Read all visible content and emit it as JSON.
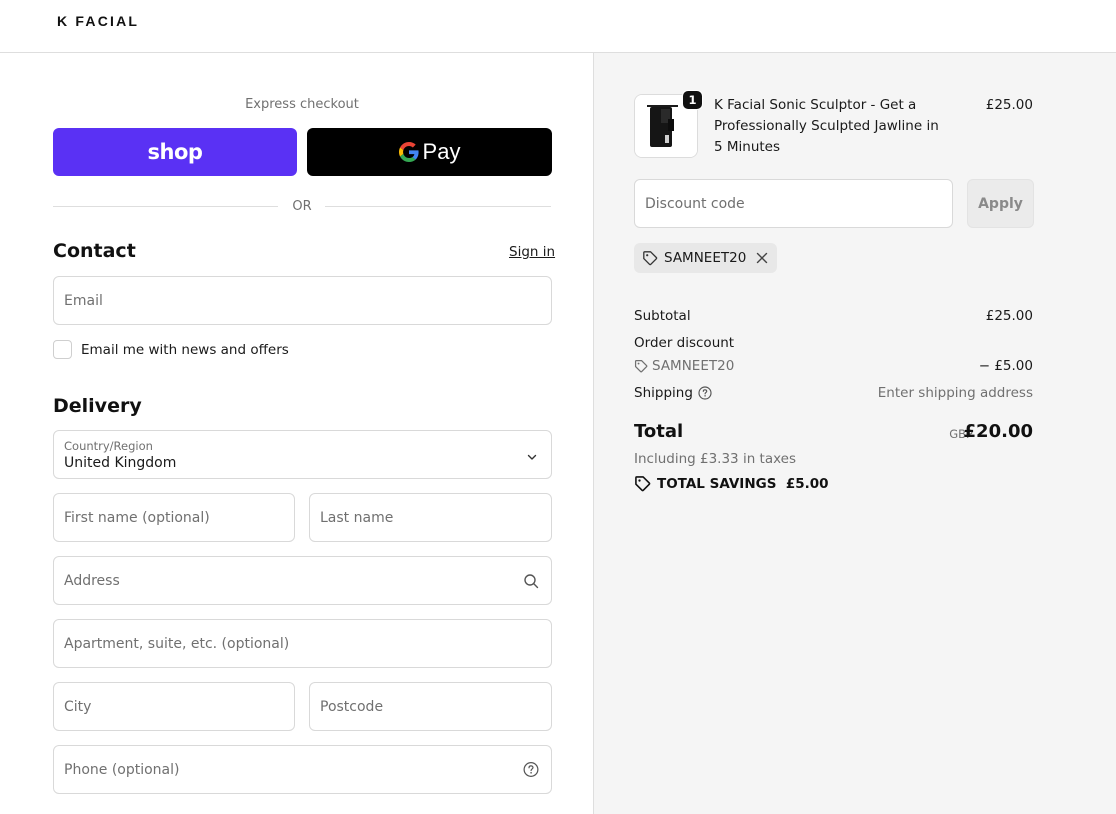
{
  "brand": {
    "logo_text": "K FACIAL"
  },
  "express": {
    "label": "Express checkout",
    "shop_label": "shop",
    "gpay_label": "Pay",
    "divider_text": "OR"
  },
  "contact": {
    "heading": "Contact",
    "signin_label": "Sign in",
    "email_placeholder": "Email",
    "newsletter_label": "Email me with news and offers"
  },
  "delivery": {
    "heading": "Delivery",
    "country_label": "Country/Region",
    "country_value": "United Kingdom",
    "first_name_placeholder": "First name (optional)",
    "last_name_placeholder": "Last name",
    "address_placeholder": "Address",
    "apartment_placeholder": "Apartment, suite, etc. (optional)",
    "city_placeholder": "City",
    "postcode_placeholder": "Postcode",
    "phone_placeholder": "Phone (optional)"
  },
  "order": {
    "item": {
      "quantity": "1",
      "title": "K Facial Sonic Sculptor - Get a Professionally Sculpted Jawline in 5 Minutes",
      "price": "£25.00"
    },
    "discount_placeholder": "Discount code",
    "apply_label": "Apply",
    "applied_code": "SAMNEET20",
    "subtotal_label": "Subtotal",
    "subtotal_value": "£25.00",
    "order_discount_label": "Order discount",
    "discount_code": "SAMNEET20",
    "discount_value": "− £5.00",
    "shipping_label": "Shipping",
    "shipping_value": "Enter shipping address",
    "total_label": "Total",
    "currency": "GBP",
    "total_value": "£20.00",
    "taxes_text": "Including £3.33 in taxes",
    "savings_text": "TOTAL SAVINGS  £5.00"
  },
  "colors": {
    "shop_purple": "#5a31f4",
    "gpay_black": "#000000",
    "summary_bg": "#f5f5f5"
  }
}
